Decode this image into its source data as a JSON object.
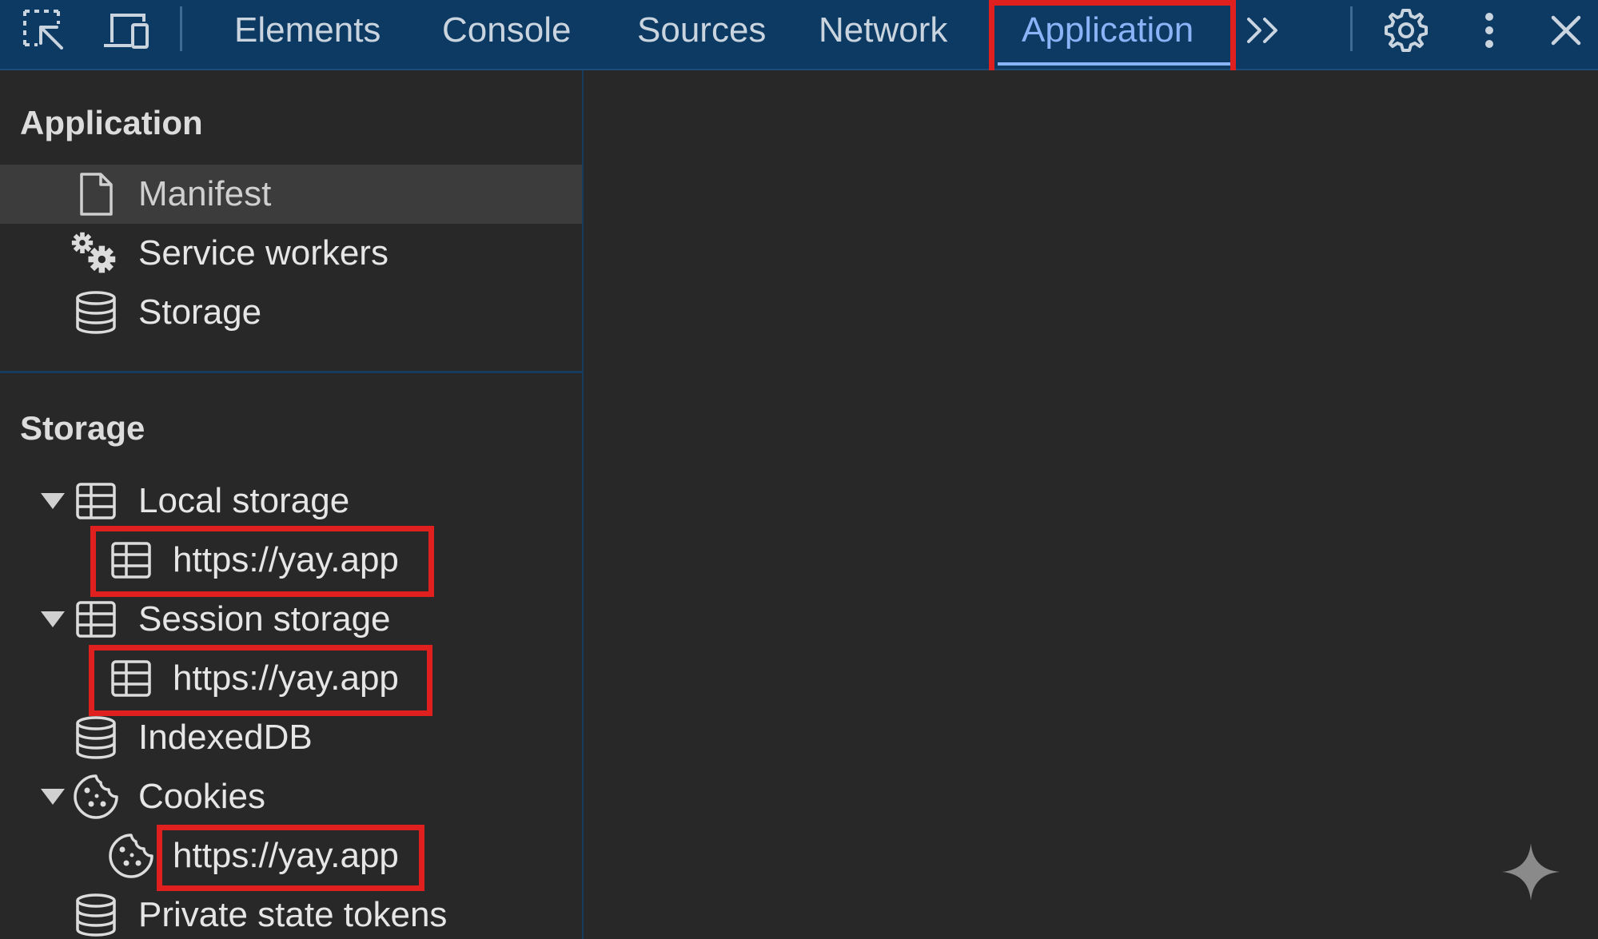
{
  "toolbar": {
    "tabs": [
      {
        "label": "Elements"
      },
      {
        "label": "Console"
      },
      {
        "label": "Sources"
      },
      {
        "label": "Network"
      },
      {
        "label": "Application",
        "active": true
      }
    ],
    "icons": [
      "inspect-element-icon",
      "device-toolbar-icon",
      "more-tabs-icon",
      "settings-icon",
      "more-options-icon",
      "close-icon"
    ]
  },
  "sidebar": {
    "application_section": {
      "title": "Application",
      "items": [
        {
          "label": "Manifest",
          "icon": "document-icon",
          "selected": true
        },
        {
          "label": "Service workers",
          "icon": "gears-icon"
        },
        {
          "label": "Storage",
          "icon": "database-icon"
        }
      ]
    },
    "storage_section": {
      "title": "Storage",
      "items": [
        {
          "label": "Local storage",
          "icon": "table-icon",
          "expanded": true
        },
        {
          "label": "https://yay.app",
          "icon": "table-icon",
          "highlighted": true
        },
        {
          "label": "Session storage",
          "icon": "table-icon",
          "expanded": true
        },
        {
          "label": "https://yay.app",
          "icon": "table-icon",
          "highlighted": true
        },
        {
          "label": "IndexedDB",
          "icon": "database-icon"
        },
        {
          "label": "Cookies",
          "icon": "cookie-icon",
          "expanded": true
        },
        {
          "label": "https://yay.app",
          "icon": "cookie-icon",
          "highlighted": true
        },
        {
          "label": "Private state tokens",
          "icon": "database-icon"
        }
      ]
    }
  },
  "colors": {
    "toolbar_bg": "#0d3a63",
    "panel_bg": "#282828",
    "selected_row_bg": "#3c3c3c",
    "active_tab": "#8ab4f8",
    "highlight_box": "#e0201e"
  }
}
